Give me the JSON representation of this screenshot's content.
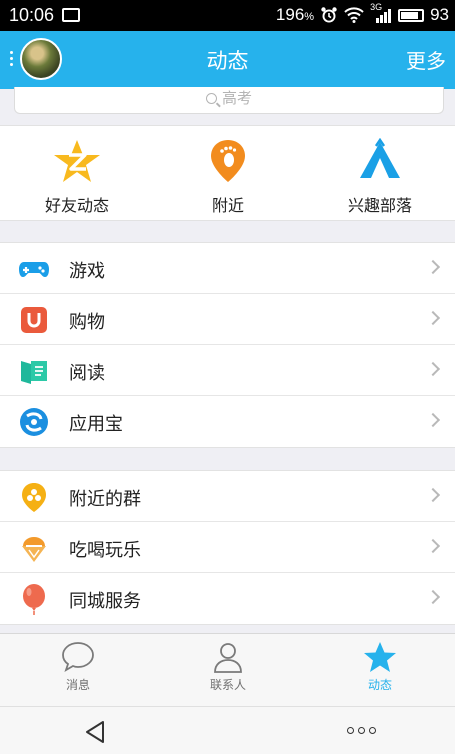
{
  "status_bar": {
    "time": "10:06",
    "network_speed": "196",
    "network_unit": "%",
    "signal_label": "3G",
    "battery": "93"
  },
  "header": {
    "title": "动态",
    "more": "更多"
  },
  "search": {
    "placeholder": "高考"
  },
  "quick_links": [
    {
      "label": "好友动态",
      "icon": "qzone-star-icon"
    },
    {
      "label": "附近",
      "icon": "footprint-pin-icon"
    },
    {
      "label": "兴趣部落",
      "icon": "tent-icon"
    }
  ],
  "group1": [
    {
      "label": "游戏",
      "icon": "gamepad-icon"
    },
    {
      "label": "购物",
      "icon": "shopping-magnet-icon"
    },
    {
      "label": "阅读",
      "icon": "book-icon"
    },
    {
      "label": "应用宝",
      "icon": "app-store-icon"
    }
  ],
  "group2": [
    {
      "label": "附近的群",
      "icon": "nearby-group-icon"
    },
    {
      "label": "吃喝玩乐",
      "icon": "ice-cream-icon"
    },
    {
      "label": "同城服务",
      "icon": "balloon-icon"
    }
  ],
  "tabs": [
    {
      "label": "消息",
      "icon": "chat-bubble-icon",
      "active": false
    },
    {
      "label": "联系人",
      "icon": "contacts-icon",
      "active": false
    },
    {
      "label": "动态",
      "icon": "star-icon",
      "active": true
    }
  ],
  "colors": {
    "accent": "#26b2ec",
    "background": "#efeff4",
    "status_bar": "#000000"
  }
}
